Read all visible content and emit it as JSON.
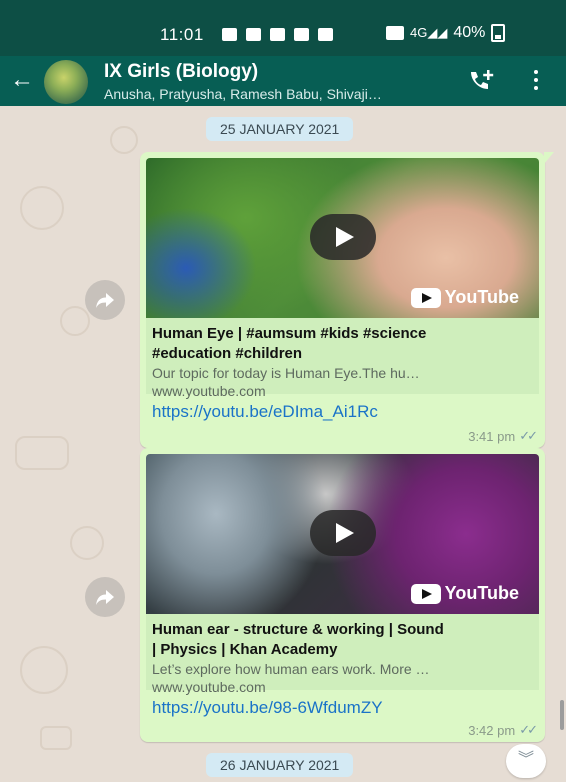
{
  "status_bar": {
    "time": "11:01",
    "battery": "40%",
    "network": "4G"
  },
  "header": {
    "title": "IX Girls (Biology)",
    "subtitle": "Anusha, Pratyusha, Ramesh Babu, Shivaji…"
  },
  "chat": {
    "date_chips": [
      "25 JANUARY 2021",
      "26 JANUARY 2021"
    ],
    "messages": [
      {
        "preview_title_line1": "Human Eye | #aumsum #kids #science",
        "preview_title_line2": "#education #children",
        "preview_description": "Our topic for today is Human Eye.The hu…",
        "preview_domain": "www.youtube.com",
        "link": "https://youtu.be/eDIma_Ai1Rc",
        "time": "3:41 pm",
        "badge": "YouTube"
      },
      {
        "preview_title_line1": "Human ear - structure & working | Sound",
        "preview_title_line2": "| Physics | Khan Academy",
        "preview_description": "Let’s explore how human ears work. More …",
        "preview_domain": "www.youtube.com",
        "link": "https://youtu.be/98-6WfdumZY",
        "time": "3:42 pm",
        "badge": "YouTube"
      }
    ]
  },
  "colors": {
    "header": "#075e54",
    "status_bar": "#0d4f45",
    "bubble": "#dcf8c6",
    "link": "#1a73c8",
    "chat_bg": "#e6ddd4"
  }
}
